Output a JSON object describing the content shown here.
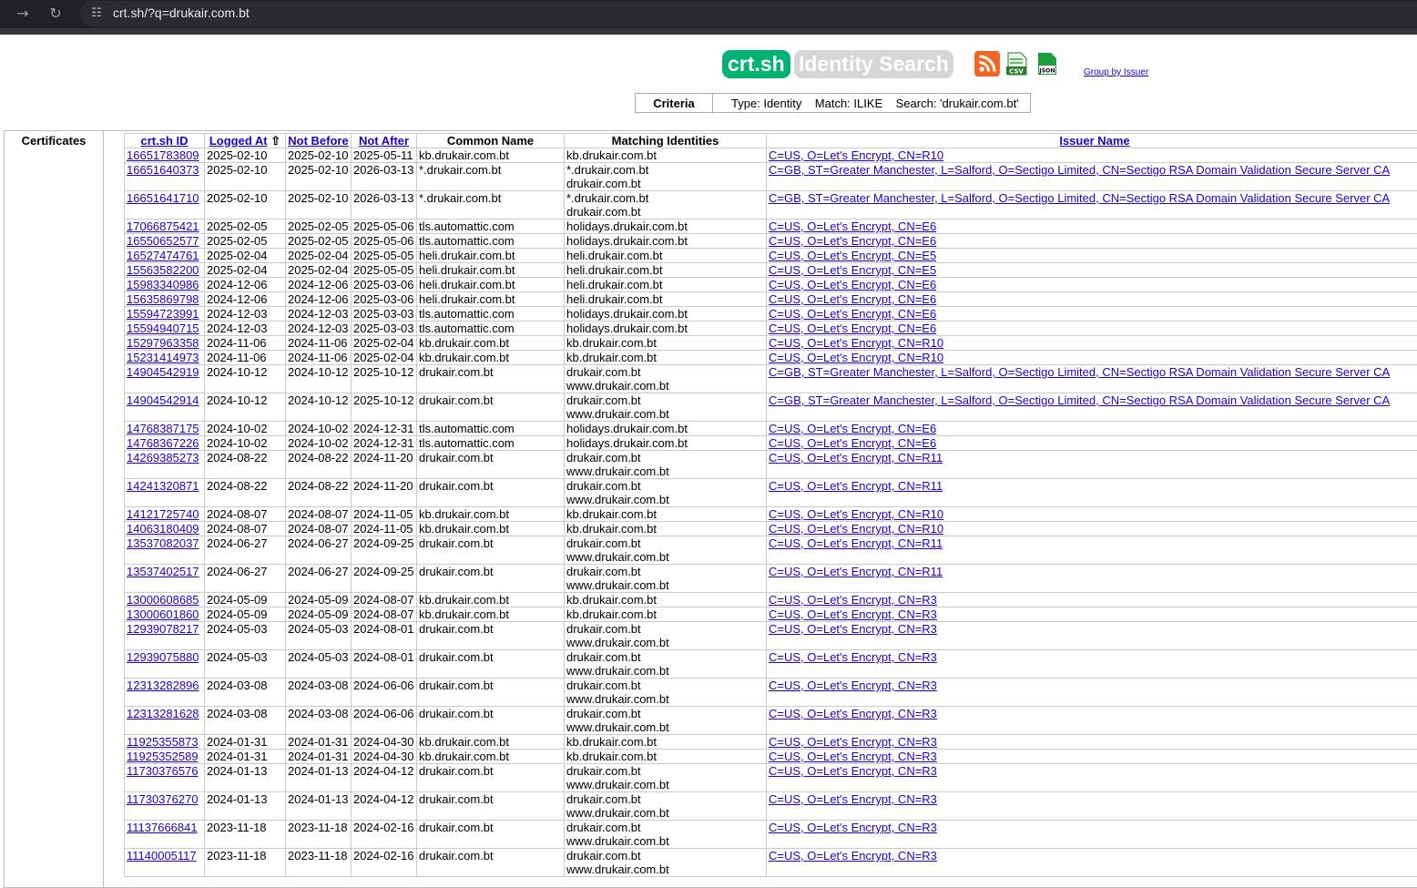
{
  "browser": {
    "url": "crt.sh/?q=drukair.com.bt",
    "back_icon": "arrow-right-icon",
    "reload_icon": "reload-icon"
  },
  "header": {
    "logo": "crt.sh",
    "subtitle": "Identity Search",
    "group_link": "Group by Issuer",
    "feeds": {
      "csv": "CSV",
      "json": "JSON"
    }
  },
  "criteria": {
    "label": "Criteria",
    "value": "Type: Identity    Match: ILIKE    Search: 'drukair.com.bt'"
  },
  "certificates_label": "Certificates",
  "table": {
    "headers": {
      "id": "crt.sh ID",
      "logged": "Logged At",
      "sort_arrow": "⇧",
      "not_before": "Not Before",
      "not_after": "Not After",
      "common_name": "Common Name",
      "matching": "Matching Identities",
      "issuer": "Issuer Name"
    },
    "rows": [
      {
        "id": "16651783809",
        "logged": "2025-02-10",
        "nb": "2025-02-10",
        "na": "2025-05-11",
        "cn": "kb.drukair.com.bt",
        "m": [
          "kb.drukair.com.bt"
        ],
        "issuer": "C=US, O=Let's Encrypt, CN=R10"
      },
      {
        "id": "16651640373",
        "logged": "2025-02-10",
        "nb": "2025-02-10",
        "na": "2026-03-13",
        "cn": "*.drukair.com.bt",
        "m": [
          "*.drukair.com.bt",
          "drukair.com.bt"
        ],
        "issuer": "C=GB, ST=Greater Manchester, L=Salford, O=Sectigo Limited, CN=Sectigo RSA Domain Validation Secure Server CA"
      },
      {
        "id": "16651641710",
        "logged": "2025-02-10",
        "nb": "2025-02-10",
        "na": "2026-03-13",
        "cn": "*.drukair.com.bt",
        "m": [
          "*.drukair.com.bt",
          "drukair.com.bt"
        ],
        "issuer": "C=GB, ST=Greater Manchester, L=Salford, O=Sectigo Limited, CN=Sectigo RSA Domain Validation Secure Server CA"
      },
      {
        "id": "17066875421",
        "logged": "2025-02-05",
        "nb": "2025-02-05",
        "na": "2025-05-06",
        "cn": "tls.automattic.com",
        "m": [
          "holidays.drukair.com.bt"
        ],
        "issuer": "C=US, O=Let's Encrypt, CN=E6"
      },
      {
        "id": "16550652577",
        "logged": "2025-02-05",
        "nb": "2025-02-05",
        "na": "2025-05-06",
        "cn": "tls.automattic.com",
        "m": [
          "holidays.drukair.com.bt"
        ],
        "issuer": "C=US, O=Let's Encrypt, CN=E6"
      },
      {
        "id": "16527474761",
        "logged": "2025-02-04",
        "nb": "2025-02-04",
        "na": "2025-05-05",
        "cn": "heli.drukair.com.bt",
        "m": [
          "heli.drukair.com.bt"
        ],
        "issuer": "C=US, O=Let's Encrypt, CN=E5"
      },
      {
        "id": "15563582200",
        "logged": "2025-02-04",
        "nb": "2025-02-04",
        "na": "2025-05-05",
        "cn": "heli.drukair.com.bt",
        "m": [
          "heli.drukair.com.bt"
        ],
        "issuer": "C=US, O=Let's Encrypt, CN=E5"
      },
      {
        "id": "15983340986",
        "logged": "2024-12-06",
        "nb": "2024-12-06",
        "na": "2025-03-06",
        "cn": "heli.drukair.com.bt",
        "m": [
          "heli.drukair.com.bt"
        ],
        "issuer": "C=US, O=Let's Encrypt, CN=E6"
      },
      {
        "id": "15635869798",
        "logged": "2024-12-06",
        "nb": "2024-12-06",
        "na": "2025-03-06",
        "cn": "heli.drukair.com.bt",
        "m": [
          "heli.drukair.com.bt"
        ],
        "issuer": "C=US, O=Let's Encrypt, CN=E6"
      },
      {
        "id": "15594723991",
        "logged": "2024-12-03",
        "nb": "2024-12-03",
        "na": "2025-03-03",
        "cn": "tls.automattic.com",
        "m": [
          "holidays.drukair.com.bt"
        ],
        "issuer": "C=US, O=Let's Encrypt, CN=E6"
      },
      {
        "id": "15594940715",
        "logged": "2024-12-03",
        "nb": "2024-12-03",
        "na": "2025-03-03",
        "cn": "tls.automattic.com",
        "m": [
          "holidays.drukair.com.bt"
        ],
        "issuer": "C=US, O=Let's Encrypt, CN=E6"
      },
      {
        "id": "15297963358",
        "logged": "2024-11-06",
        "nb": "2024-11-06",
        "na": "2025-02-04",
        "cn": "kb.drukair.com.bt",
        "m": [
          "kb.drukair.com.bt"
        ],
        "issuer": "C=US, O=Let's Encrypt, CN=R10"
      },
      {
        "id": "15231414973",
        "logged": "2024-11-06",
        "nb": "2024-11-06",
        "na": "2025-02-04",
        "cn": "kb.drukair.com.bt",
        "m": [
          "kb.drukair.com.bt"
        ],
        "issuer": "C=US, O=Let's Encrypt, CN=R10"
      },
      {
        "id": "14904542919",
        "logged": "2024-10-12",
        "nb": "2024-10-12",
        "na": "2025-10-12",
        "cn": "drukair.com.bt",
        "m": [
          "drukair.com.bt",
          "www.drukair.com.bt"
        ],
        "issuer": "C=GB, ST=Greater Manchester, L=Salford, O=Sectigo Limited, CN=Sectigo RSA Domain Validation Secure Server CA"
      },
      {
        "id": "14904542914",
        "logged": "2024-10-12",
        "nb": "2024-10-12",
        "na": "2025-10-12",
        "cn": "drukair.com.bt",
        "m": [
          "drukair.com.bt",
          "www.drukair.com.bt"
        ],
        "issuer": "C=GB, ST=Greater Manchester, L=Salford, O=Sectigo Limited, CN=Sectigo RSA Domain Validation Secure Server CA"
      },
      {
        "id": "14768387175",
        "logged": "2024-10-02",
        "nb": "2024-10-02",
        "na": "2024-12-31",
        "cn": "tls.automattic.com",
        "m": [
          "holidays.drukair.com.bt"
        ],
        "issuer": "C=US, O=Let's Encrypt, CN=E6"
      },
      {
        "id": "14768367226",
        "logged": "2024-10-02",
        "nb": "2024-10-02",
        "na": "2024-12-31",
        "cn": "tls.automattic.com",
        "m": [
          "holidays.drukair.com.bt"
        ],
        "issuer": "C=US, O=Let's Encrypt, CN=E6"
      },
      {
        "id": "14269385273",
        "logged": "2024-08-22",
        "nb": "2024-08-22",
        "na": "2024-11-20",
        "cn": "drukair.com.bt",
        "m": [
          "drukair.com.bt",
          "www.drukair.com.bt"
        ],
        "issuer": "C=US, O=Let's Encrypt, CN=R11"
      },
      {
        "id": "14241320871",
        "logged": "2024-08-22",
        "nb": "2024-08-22",
        "na": "2024-11-20",
        "cn": "drukair.com.bt",
        "m": [
          "drukair.com.bt",
          "www.drukair.com.bt"
        ],
        "issuer": "C=US, O=Let's Encrypt, CN=R11"
      },
      {
        "id": "14121725740",
        "logged": "2024-08-07",
        "nb": "2024-08-07",
        "na": "2024-11-05",
        "cn": "kb.drukair.com.bt",
        "m": [
          "kb.drukair.com.bt"
        ],
        "issuer": "C=US, O=Let's Encrypt, CN=R10"
      },
      {
        "id": "14063180409",
        "logged": "2024-08-07",
        "nb": "2024-08-07",
        "na": "2024-11-05",
        "cn": "kb.drukair.com.bt",
        "m": [
          "kb.drukair.com.bt"
        ],
        "issuer": "C=US, O=Let's Encrypt, CN=R10"
      },
      {
        "id": "13537082037",
        "logged": "2024-06-27",
        "nb": "2024-06-27",
        "na": "2024-09-25",
        "cn": "drukair.com.bt",
        "m": [
          "drukair.com.bt",
          "www.drukair.com.bt"
        ],
        "issuer": "C=US, O=Let's Encrypt, CN=R11"
      },
      {
        "id": "13537402517",
        "logged": "2024-06-27",
        "nb": "2024-06-27",
        "na": "2024-09-25",
        "cn": "drukair.com.bt",
        "m": [
          "drukair.com.bt",
          "www.drukair.com.bt"
        ],
        "issuer": "C=US, O=Let's Encrypt, CN=R11"
      },
      {
        "id": "13000608685",
        "logged": "2024-05-09",
        "nb": "2024-05-09",
        "na": "2024-08-07",
        "cn": "kb.drukair.com.bt",
        "m": [
          "kb.drukair.com.bt"
        ],
        "issuer": "C=US, O=Let's Encrypt, CN=R3"
      },
      {
        "id": "13000601860",
        "logged": "2024-05-09",
        "nb": "2024-05-09",
        "na": "2024-08-07",
        "cn": "kb.drukair.com.bt",
        "m": [
          "kb.drukair.com.bt"
        ],
        "issuer": "C=US, O=Let's Encrypt, CN=R3"
      },
      {
        "id": "12939078217",
        "logged": "2024-05-03",
        "nb": "2024-05-03",
        "na": "2024-08-01",
        "cn": "drukair.com.bt",
        "m": [
          "drukair.com.bt",
          "www.drukair.com.bt"
        ],
        "issuer": "C=US, O=Let's Encrypt, CN=R3"
      },
      {
        "id": "12939075880",
        "logged": "2024-05-03",
        "nb": "2024-05-03",
        "na": "2024-08-01",
        "cn": "drukair.com.bt",
        "m": [
          "drukair.com.bt",
          "www.drukair.com.bt"
        ],
        "issuer": "C=US, O=Let's Encrypt, CN=R3"
      },
      {
        "id": "12313282896",
        "logged": "2024-03-08",
        "nb": "2024-03-08",
        "na": "2024-06-06",
        "cn": "drukair.com.bt",
        "m": [
          "drukair.com.bt",
          "www.drukair.com.bt"
        ],
        "issuer": "C=US, O=Let's Encrypt, CN=R3"
      },
      {
        "id": "12313281628",
        "logged": "2024-03-08",
        "nb": "2024-03-08",
        "na": "2024-06-06",
        "cn": "drukair.com.bt",
        "m": [
          "drukair.com.bt",
          "www.drukair.com.bt"
        ],
        "issuer": "C=US, O=Let's Encrypt, CN=R3"
      },
      {
        "id": "11925355873",
        "logged": "2024-01-31",
        "nb": "2024-01-31",
        "na": "2024-04-30",
        "cn": "kb.drukair.com.bt",
        "m": [
          "kb.drukair.com.bt"
        ],
        "issuer": "C=US, O=Let's Encrypt, CN=R3"
      },
      {
        "id": "11925352589",
        "logged": "2024-01-31",
        "nb": "2024-01-31",
        "na": "2024-04-30",
        "cn": "kb.drukair.com.bt",
        "m": [
          "kb.drukair.com.bt"
        ],
        "issuer": "C=US, O=Let's Encrypt, CN=R3"
      },
      {
        "id": "11730376576",
        "logged": "2024-01-13",
        "nb": "2024-01-13",
        "na": "2024-04-12",
        "cn": "drukair.com.bt",
        "m": [
          "drukair.com.bt",
          "www.drukair.com.bt"
        ],
        "issuer": "C=US, O=Let's Encrypt, CN=R3"
      },
      {
        "id": "11730376270",
        "logged": "2024-01-13",
        "nb": "2024-01-13",
        "na": "2024-04-12",
        "cn": "drukair.com.bt",
        "m": [
          "drukair.com.bt",
          "www.drukair.com.bt"
        ],
        "issuer": "C=US, O=Let's Encrypt, CN=R3"
      },
      {
        "id": "11137666841",
        "logged": "2023-11-18",
        "nb": "2023-11-18",
        "na": "2024-02-16",
        "cn": "drukair.com.bt",
        "m": [
          "drukair.com.bt",
          "www.drukair.com.bt"
        ],
        "issuer": "C=US, O=Let's Encrypt, CN=R3"
      },
      {
        "id": "11140005117",
        "logged": "2023-11-18",
        "nb": "2023-11-18",
        "na": "2024-02-16",
        "cn": "drukair.com.bt",
        "m": [
          "drukair.com.bt",
          "www.drukair.com.bt"
        ],
        "issuer": "C=US, O=Let's Encrypt, CN=R3"
      }
    ]
  }
}
